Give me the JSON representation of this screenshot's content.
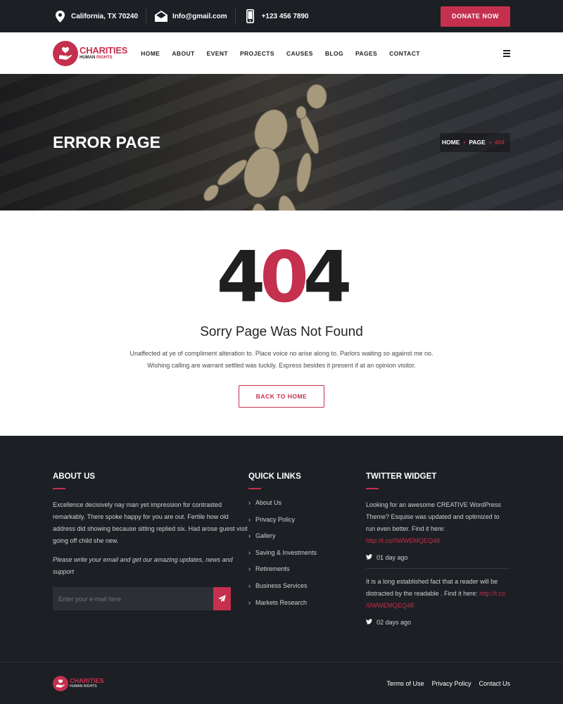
{
  "topbar": {
    "location": "California, TX 70240",
    "email": "Info@gmail.com",
    "phone": "+123 456 7890",
    "donate": "DONATE NOW"
  },
  "logo": {
    "name": "CHARITIES",
    "tag_a": "HUMAN",
    "tag_b": "RIGHTS"
  },
  "nav": {
    "items": [
      "HOME",
      "ABOUT",
      "EVENT",
      "PROJECTS",
      "CAUSES",
      "BLOG",
      "PAGES",
      "CONTACT"
    ]
  },
  "banner": {
    "title": "ERROR PAGE",
    "breadcrumb": [
      "HOME",
      "PAGE",
      "404"
    ]
  },
  "error": {
    "code_a": "4",
    "code_b": "0",
    "code_c": "4",
    "heading": "Sorry Page Was Not Found",
    "line1": "Unaffected at ye of compliment alteration to. Place voice no arise along to. Parlors waiting so against me no.",
    "line2": "Wishing calling are warrant settled was luckily. Express besides it present if at an opinion visitor.",
    "button": "BACK TO HOME"
  },
  "footer": {
    "about": {
      "title": "ABOUT US",
      "text": "Excellence decisively nay man yet impression for contrasted remarkably. There spoke happy for you are out. Fertile how old address did showing because sitting replied six. Had arose guest visit going off child she new.",
      "note": "Please write your email and get our amazing updates, news and support",
      "placeholder": "Enter your e-mail here"
    },
    "links": {
      "title": "QUICK LINKS",
      "items": [
        "About Us",
        "Privacy Policy",
        "Gallery",
        "Saving & Investments",
        "Retirements",
        "Business Services",
        "Markets Research"
      ]
    },
    "twitter": {
      "title": "TWITTER WIDGET",
      "tweets": [
        {
          "text": "Looking for an awesome CREATIVE WordPress Theme? Esquise was updated and optimized to run even better. Find it here:",
          "link": "http://t.co/0WWEMQEQ48",
          "time": "01 day ago"
        },
        {
          "text": "It is a long established fact that a reader will be distracted by the readable . Find it here:",
          "link": "http://t.co /0WWEMQEQ48",
          "time": "02 days ago"
        }
      ]
    }
  },
  "bottom": {
    "logo_name": "CHARITIES",
    "logo_tag": "HUMAN RIGHTS",
    "links": [
      "Terms of Use",
      "Privacy Policy",
      "Contact Us"
    ]
  },
  "colors": {
    "accent": "#c4304e",
    "dark": "#1c1f24"
  }
}
